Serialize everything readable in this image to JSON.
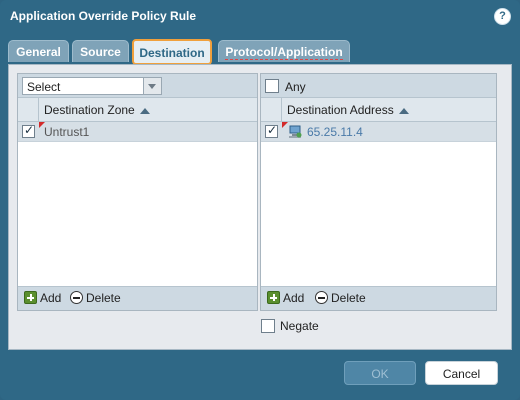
{
  "dialog": {
    "title": "Application Override Policy Rule",
    "help_icon": "?"
  },
  "tabs": [
    {
      "label": "General"
    },
    {
      "label": "Source"
    },
    {
      "label": "Destination"
    },
    {
      "label": "Protocol/Application"
    }
  ],
  "active_tab": "Destination",
  "zone_panel": {
    "select_value": "Select",
    "column_header": "Destination Zone",
    "rows": [
      {
        "checked": true,
        "name": "Untrust1"
      }
    ],
    "add_label": "Add",
    "delete_label": "Delete"
  },
  "address_panel": {
    "any_label": "Any",
    "any_checked": false,
    "column_header": "Destination Address",
    "rows": [
      {
        "checked": true,
        "address": "65.25.11.4"
      }
    ],
    "add_label": "Add",
    "delete_label": "Delete",
    "negate_label": "Negate",
    "negate_checked": false
  },
  "buttons": {
    "ok_label": "OK",
    "cancel_label": "Cancel"
  },
  "colors": {
    "dialog_bg": "#2f6886",
    "active_tab_border": "#f0a03c",
    "address_link": "#4a7aa8"
  }
}
